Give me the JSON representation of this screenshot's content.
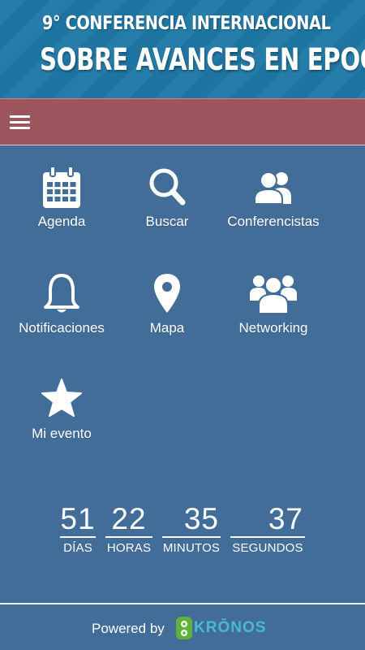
{
  "header": {
    "line1": "9° CONFERENCIA INTERNACIONAL",
    "line2": "SOBRE AVANCES EN EPOC"
  },
  "menu": {
    "items": [
      {
        "label": "Agenda",
        "icon": "calendar-icon"
      },
      {
        "label": "Buscar",
        "icon": "search-icon"
      },
      {
        "label": "Conferencistas",
        "icon": "users-icon"
      },
      {
        "label": "Notificaciones",
        "icon": "bell-icon"
      },
      {
        "label": "Mapa",
        "icon": "map-marker-icon"
      },
      {
        "label": "Networking",
        "icon": "group-icon"
      },
      {
        "label": "Mi evento",
        "icon": "star-icon"
      }
    ]
  },
  "countdown": {
    "days": {
      "value": "51",
      "label": "DÍAS"
    },
    "hours": {
      "value": "22",
      "label": "HORAS"
    },
    "minutes": {
      "value": "35",
      "label": "MINUTOS"
    },
    "seconds": {
      "value": "37",
      "label": "SEGUNDOS"
    }
  },
  "footer": {
    "powered_by": "Powered by",
    "brand": "KRŌNOS"
  },
  "colors": {
    "background": "#426d98",
    "header": "#1f78a6",
    "navbar": "#9c555c",
    "brand": "#4ab8d6"
  }
}
